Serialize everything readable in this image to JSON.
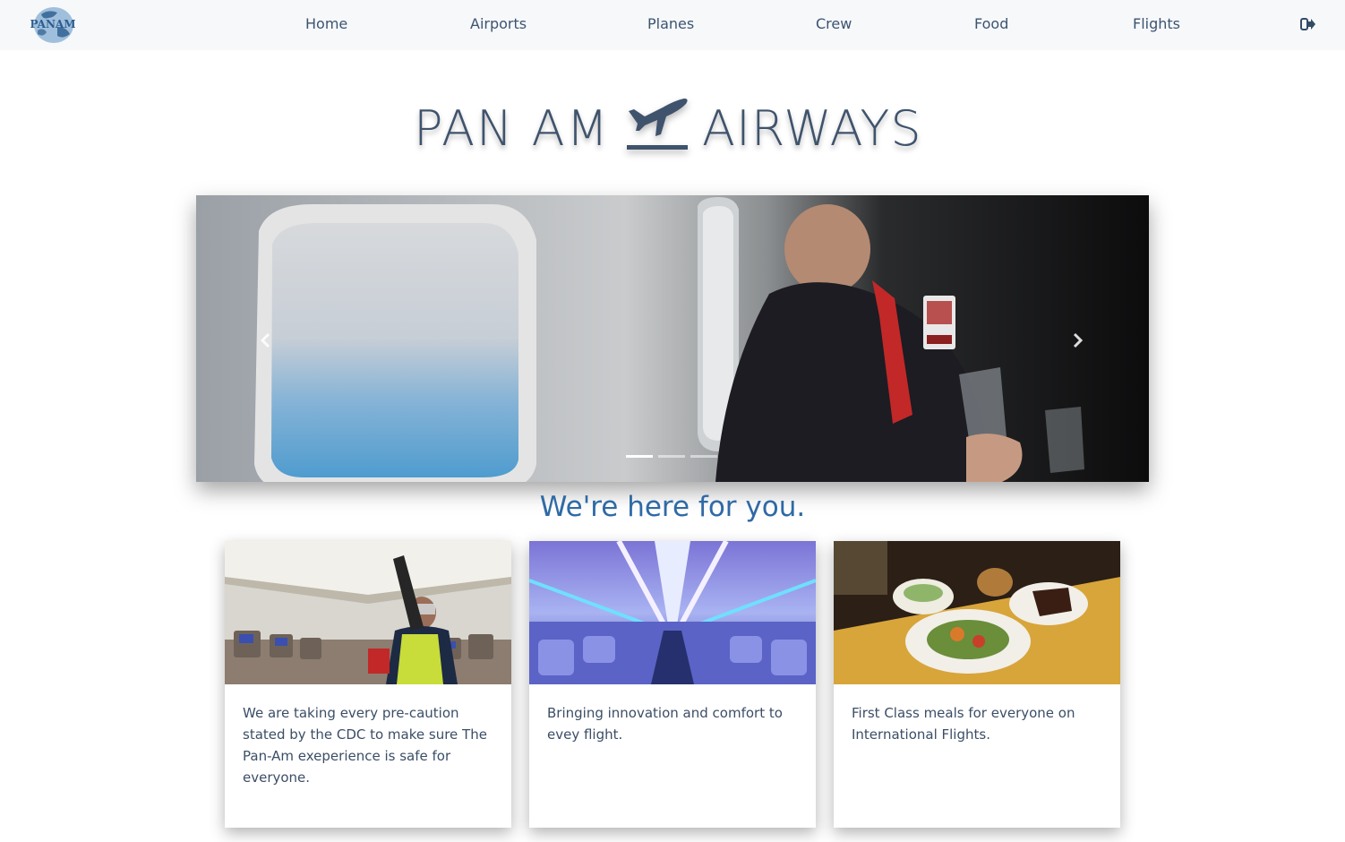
{
  "navbar": {
    "logo_text": "PANAM",
    "links": [
      "Home",
      "Airports",
      "Planes",
      "Crew",
      "Food",
      "Flights"
    ],
    "logout_icon": "sign-out-icon"
  },
  "brand": {
    "left": "PAN AM",
    "right": "AIRWAYS",
    "icon": "airplane-takeoff-icon"
  },
  "carousel": {
    "slide_count": 3,
    "active_index": 0,
    "prev_icon": "chevron-left-icon",
    "next_icon": "chevron-right-icon"
  },
  "tagline": "We're here for you.",
  "cards": [
    {
      "text": "We are taking every pre-caution stated by the CDC to make sure The Pan-Am exeperience is safe for everyone."
    },
    {
      "text": "Bringing innovation and comfort to evey flight."
    },
    {
      "text": "First Class meals for everyone on International Flights."
    }
  ],
  "colors": {
    "nav_bg": "#f7f8fa",
    "brand_text": "#3f536c",
    "tagline": "#2f6aa6",
    "nav_link": "#3b5470"
  }
}
